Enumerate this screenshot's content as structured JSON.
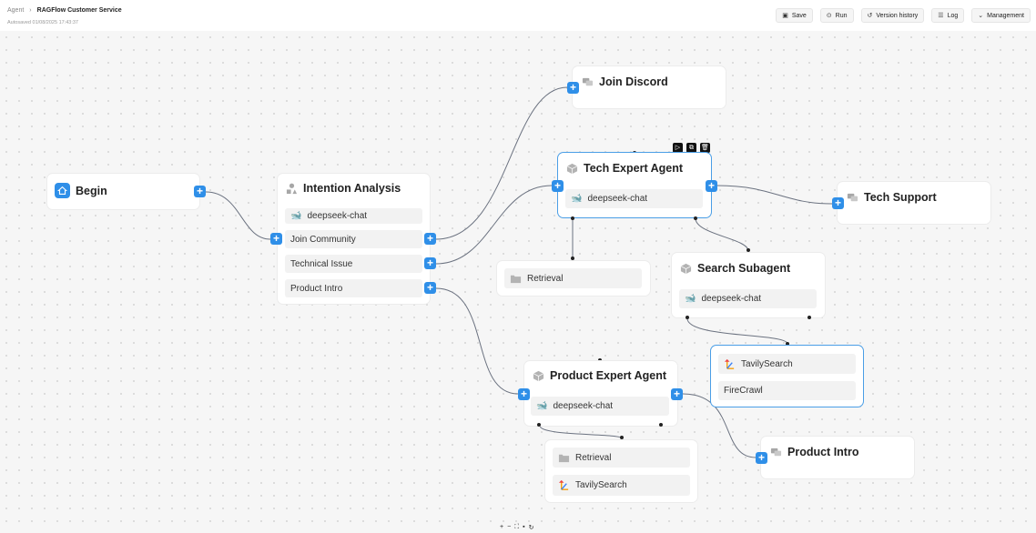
{
  "header": {
    "breadcrumb_root": "Agent",
    "breadcrumb_sep": "›",
    "breadcrumb_current": "RAGFlow Customer Service",
    "autosaved": "Autosaved 01/08/2025 17:43:37",
    "actions": [
      "Save",
      "Run",
      "Version history",
      "Log",
      "Management"
    ]
  },
  "nodes": {
    "begin": {
      "title": "Begin"
    },
    "intention": {
      "title": "Intention Analysis",
      "model": "deepseek-chat",
      "items": [
        "Join Community",
        "Technical Issue",
        "Product Intro"
      ]
    },
    "join_discord": {
      "title": "Join Discord"
    },
    "tech_expert": {
      "title": "Tech Expert Agent",
      "model": "deepseek-chat"
    },
    "tech_support": {
      "title": "Tech Support"
    },
    "retrieval_1": {
      "label": "Retrieval"
    },
    "search_subagent": {
      "title": "Search Subagent",
      "model": "deepseek-chat"
    },
    "tools_box": {
      "items": [
        "TavilySearch",
        "FireCrawl"
      ]
    },
    "product_expert": {
      "title": "Product Expert Agent",
      "model": "deepseek-chat"
    },
    "product_tools": {
      "items": [
        "Retrieval",
        "TavilySearch"
      ]
    },
    "product_intro": {
      "title": "Product Intro"
    }
  },
  "icons": {
    "home": "home-icon",
    "chat": "chat-bubbles-icon",
    "cube": "cube-icon",
    "shapes": "shapes-icon",
    "model": "deepseek-whale-icon",
    "folder": "folder-icon",
    "tavily": "tavily-icon",
    "node_toolbar": [
      "run-icon",
      "copy-icon",
      "delete-icon"
    ],
    "canvas_controls": [
      "zoom-in-icon",
      "zoom-out-icon",
      "fit-view-icon",
      "lock-icon",
      "refresh-icon"
    ]
  },
  "colors": {
    "accent": "#2f8fe8",
    "selected_border": "#4a9ee6",
    "edge": "#6b7280",
    "model_icon": "#4d6bfe"
  }
}
